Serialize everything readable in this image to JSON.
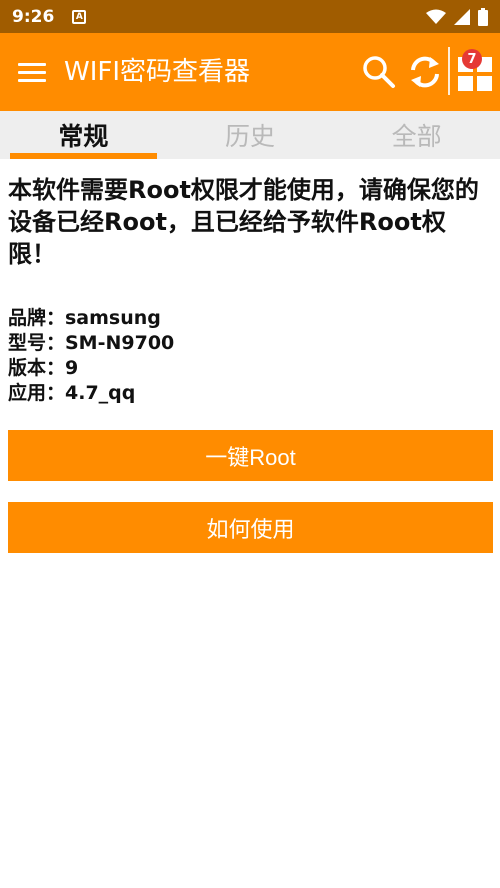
{
  "status_bar": {
    "time": "9:26",
    "notification_letter": "A"
  },
  "app_bar": {
    "title": "WIFI密码查看器",
    "badge_count": "7"
  },
  "tabs": [
    {
      "label": "常规",
      "active": true
    },
    {
      "label": "历史",
      "active": false
    },
    {
      "label": "全部",
      "active": false
    }
  ],
  "notice": "本软件需要Root权限才能使用，请确保您的设备已经Root，且已经给予软件Root权限！",
  "device_info": {
    "brand": "品牌：samsung",
    "model": "型号：SM-N9700",
    "version": "版本：9",
    "app": "应用：4.7_qq"
  },
  "buttons": {
    "one_click_root": "一键Root",
    "how_to_use": "如何使用"
  },
  "colors": {
    "accent": "#ff8c00",
    "status_bar": "#a05c00",
    "badge": "#e53935"
  }
}
